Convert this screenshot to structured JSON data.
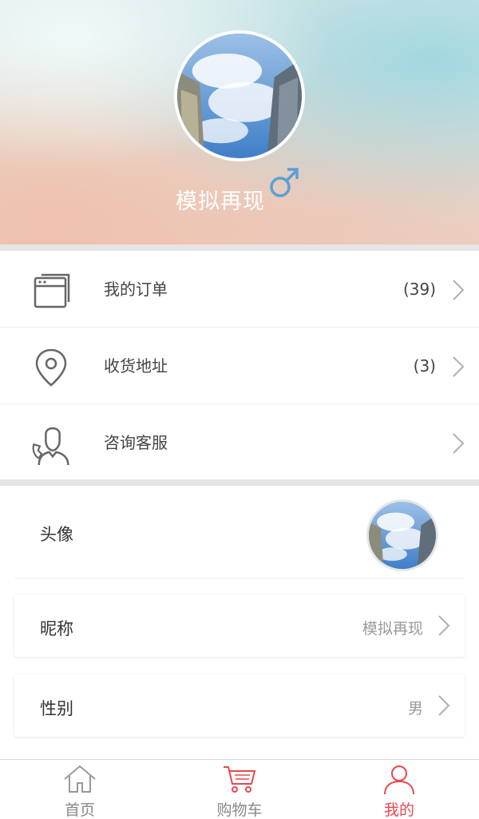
{
  "profile": {
    "username": "模拟再现",
    "gender_symbol": "male-symbol"
  },
  "menu": [
    {
      "label": "我的订单",
      "count": "(39)",
      "icon": "order-icon"
    },
    {
      "label": "收货地址",
      "count": "(3)",
      "icon": "location-pin-icon"
    },
    {
      "label": "咨询客服",
      "count": "",
      "icon": "customer-service-icon"
    }
  ],
  "settings": {
    "avatar_label": "头像",
    "nickname_label": "昵称",
    "nickname_value": "模拟再现",
    "gender_label": "性别",
    "gender_value": "男"
  },
  "tabbar": {
    "tabs": [
      {
        "label": "首页",
        "icon": "home-icon"
      },
      {
        "label": "购物车",
        "icon": "cart-icon"
      },
      {
        "label": "我的",
        "icon": "user-icon"
      }
    ],
    "active_color": "#e8474c"
  },
  "colors": {
    "accent": "#e8474c",
    "gender_icon": "#5aa0d8"
  }
}
